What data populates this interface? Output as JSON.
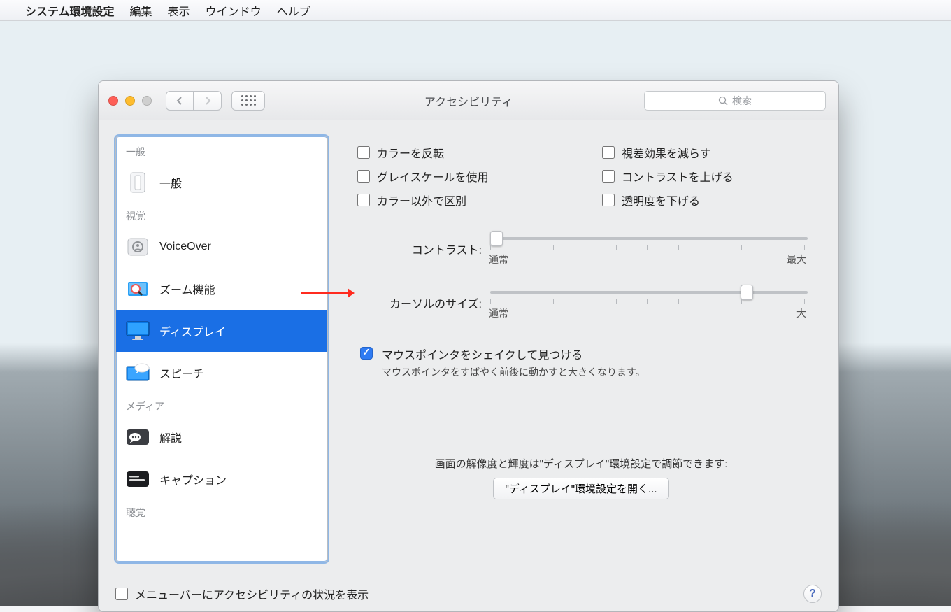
{
  "menubar": {
    "apple": "",
    "app_name": "システム環境設定",
    "items": [
      "編集",
      "表示",
      "ウインドウ",
      "ヘルプ"
    ]
  },
  "window": {
    "title": "アクセシビリティ",
    "search_placeholder": "検索"
  },
  "sidebar": {
    "section_general": "一般",
    "item_general": "一般",
    "section_vision": "視覚",
    "item_voiceover": "VoiceOver",
    "item_zoom": "ズーム機能",
    "item_display": "ディスプレイ",
    "item_speech": "スピーチ",
    "section_media": "メディア",
    "item_descriptions": "解説",
    "item_captions": "キャプション",
    "section_hearing": "聴覚"
  },
  "content": {
    "invert_colors": "カラーを反転",
    "reduce_motion": "視差効果を減らす",
    "grayscale": "グレイスケールを使用",
    "increase_contrast": "コントラストを上げる",
    "differentiate": "カラー以外で区別",
    "reduce_transparency": "透明度を下げる",
    "contrast_label": "コントラスト:",
    "contrast_min": "通常",
    "contrast_max": "最大",
    "cursor_label": "カーソルのサイズ:",
    "cursor_min": "通常",
    "cursor_max": "大",
    "shake_title": "マウスポインタをシェイクして見つける",
    "shake_desc": "マウスポインタをすばやく前後に動かすと大きくなります。",
    "display_note": "画面の解像度と輝度は\"ディスプレイ\"環境設定で調節できます:",
    "open_display": "\"ディスプレイ\"環境設定を開く..."
  },
  "bottom": {
    "show_status": "メニューバーにアクセシビリティの状況を表示"
  }
}
